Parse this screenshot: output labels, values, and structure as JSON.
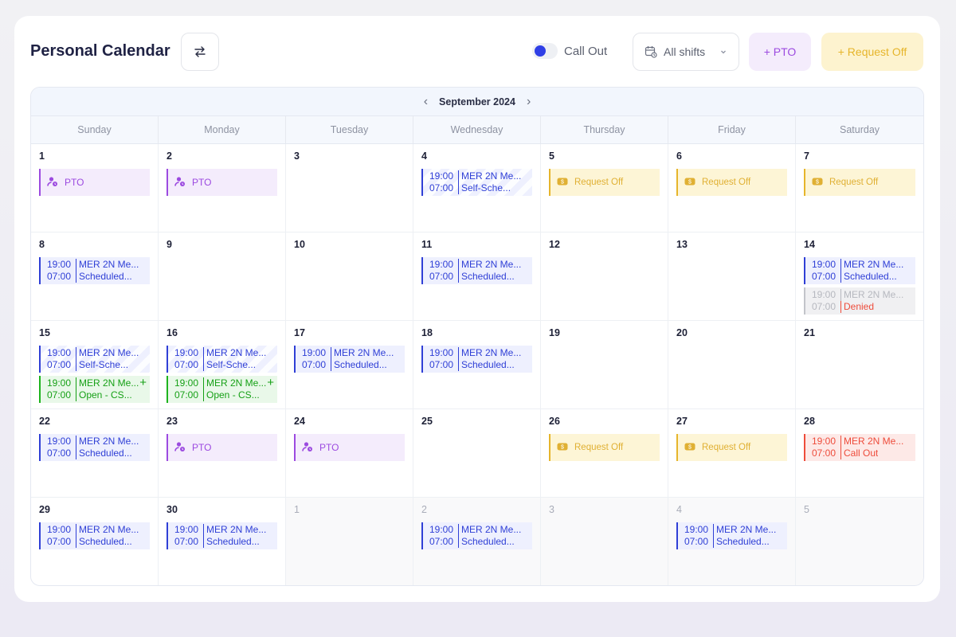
{
  "header": {
    "title": "Personal Calendar",
    "swap_icon": "swap-arrows-icon",
    "callout_label": "Call Out",
    "shift_filter": "All shifts",
    "pto_label": "+ PTO",
    "request_off_label": "+ Request Off"
  },
  "calendar": {
    "month_label": "September 2024",
    "weekdays": [
      "Sunday",
      "Monday",
      "Tuesday",
      "Wednesday",
      "Thursday",
      "Friday",
      "Saturday"
    ],
    "weeks": [
      [
        {
          "day": "1",
          "events": [
            {
              "type": "pto",
              "label": "PTO"
            }
          ]
        },
        {
          "day": "2",
          "events": [
            {
              "type": "pto",
              "label": "PTO"
            }
          ]
        },
        {
          "day": "3",
          "events": []
        },
        {
          "day": "4",
          "events": [
            {
              "type": "shift",
              "color": "blue",
              "hatch": true,
              "start": "19:00",
              "end": "07:00",
              "title": "MER 2N Me...",
              "status": "Self-Sche..."
            }
          ]
        },
        {
          "day": "5",
          "events": [
            {
              "type": "request",
              "label": "Request Off"
            }
          ]
        },
        {
          "day": "6",
          "events": [
            {
              "type": "request",
              "label": "Request Off"
            }
          ]
        },
        {
          "day": "7",
          "events": [
            {
              "type": "request",
              "label": "Request Off"
            }
          ]
        }
      ],
      [
        {
          "day": "8",
          "events": [
            {
              "type": "shift",
              "color": "blue",
              "start": "19:00",
              "end": "07:00",
              "title": "MER 2N Me...",
              "status": "Scheduled..."
            }
          ]
        },
        {
          "day": "9",
          "events": []
        },
        {
          "day": "10",
          "events": []
        },
        {
          "day": "11",
          "events": [
            {
              "type": "shift",
              "color": "blue",
              "start": "19:00",
              "end": "07:00",
              "title": "MER 2N Me...",
              "status": "Scheduled..."
            }
          ]
        },
        {
          "day": "12",
          "events": []
        },
        {
          "day": "13",
          "events": []
        },
        {
          "day": "14",
          "events": [
            {
              "type": "shift",
              "color": "blue",
              "start": "19:00",
              "end": "07:00",
              "title": "MER 2N Me...",
              "status": "Scheduled..."
            },
            {
              "type": "shift",
              "color": "grey",
              "start": "19:00",
              "end": "07:00",
              "title": "MER 2N Me...",
              "status": "Denied"
            }
          ]
        }
      ],
      [
        {
          "day": "15",
          "events": [
            {
              "type": "shift",
              "color": "blue",
              "hatch": true,
              "start": "19:00",
              "end": "07:00",
              "title": "MER 2N Me...",
              "status": "Self-Sche..."
            },
            {
              "type": "shift",
              "color": "green",
              "plus": true,
              "start": "19:00",
              "end": "07:00",
              "title": "MER 2N Me...",
              "status": "Open - CS..."
            }
          ]
        },
        {
          "day": "16",
          "events": [
            {
              "type": "shift",
              "color": "blue",
              "hatch": true,
              "start": "19:00",
              "end": "07:00",
              "title": "MER 2N Me...",
              "status": "Self-Sche..."
            },
            {
              "type": "shift",
              "color": "green",
              "plus": true,
              "start": "19:00",
              "end": "07:00",
              "title": "MER 2N Me...",
              "status": "Open - CS..."
            }
          ]
        },
        {
          "day": "17",
          "events": [
            {
              "type": "shift",
              "color": "blue",
              "start": "19:00",
              "end": "07:00",
              "title": "MER 2N Me...",
              "status": "Scheduled..."
            }
          ]
        },
        {
          "day": "18",
          "events": [
            {
              "type": "shift",
              "color": "blue",
              "start": "19:00",
              "end": "07:00",
              "title": "MER 2N Me...",
              "status": "Scheduled..."
            }
          ]
        },
        {
          "day": "19",
          "events": []
        },
        {
          "day": "20",
          "events": []
        },
        {
          "day": "21",
          "events": []
        }
      ],
      [
        {
          "day": "22",
          "events": [
            {
              "type": "shift",
              "color": "blue",
              "start": "19:00",
              "end": "07:00",
              "title": "MER 2N Me...",
              "status": "Scheduled..."
            }
          ]
        },
        {
          "day": "23",
          "events": [
            {
              "type": "pto",
              "label": "PTO"
            }
          ]
        },
        {
          "day": "24",
          "events": [
            {
              "type": "pto",
              "hatch": true,
              "label": "PTO"
            }
          ]
        },
        {
          "day": "25",
          "events": []
        },
        {
          "day": "26",
          "events": [
            {
              "type": "request",
              "hatch": true,
              "label": "Request Off"
            }
          ]
        },
        {
          "day": "27",
          "events": [
            {
              "type": "request",
              "hatch": true,
              "label": "Request Off"
            }
          ]
        },
        {
          "day": "28",
          "events": [
            {
              "type": "shift",
              "color": "red",
              "start": "19:00",
              "end": "07:00",
              "title": "MER 2N Me...",
              "status": "Call Out"
            }
          ]
        }
      ],
      [
        {
          "day": "29",
          "events": [
            {
              "type": "shift",
              "color": "blue",
              "start": "19:00",
              "end": "07:00",
              "title": "MER 2N Me...",
              "status": "Scheduled..."
            }
          ]
        },
        {
          "day": "30",
          "events": [
            {
              "type": "shift",
              "color": "blue",
              "start": "19:00",
              "end": "07:00",
              "title": "MER 2N Me...",
              "status": "Scheduled..."
            }
          ]
        },
        {
          "day": "1",
          "other": true,
          "events": []
        },
        {
          "day": "2",
          "other": true,
          "events": [
            {
              "type": "shift",
              "color": "blue",
              "start": "19:00",
              "end": "07:00",
              "title": "MER 2N Me...",
              "status": "Scheduled..."
            }
          ]
        },
        {
          "day": "3",
          "other": true,
          "events": []
        },
        {
          "day": "4",
          "other": true,
          "events": [
            {
              "type": "shift",
              "color": "blue",
              "start": "19:00",
              "end": "07:00",
              "title": "MER 2N Me...",
              "status": "Scheduled..."
            }
          ]
        },
        {
          "day": "5",
          "other": true,
          "events": []
        }
      ]
    ]
  },
  "colors": {
    "blue": "#2f3fd6",
    "green": "#16a016",
    "purple": "#9c4ae0",
    "yellow": "#e6b52b",
    "red": "#ee4c3b",
    "grey": "#b6b8bf"
  }
}
